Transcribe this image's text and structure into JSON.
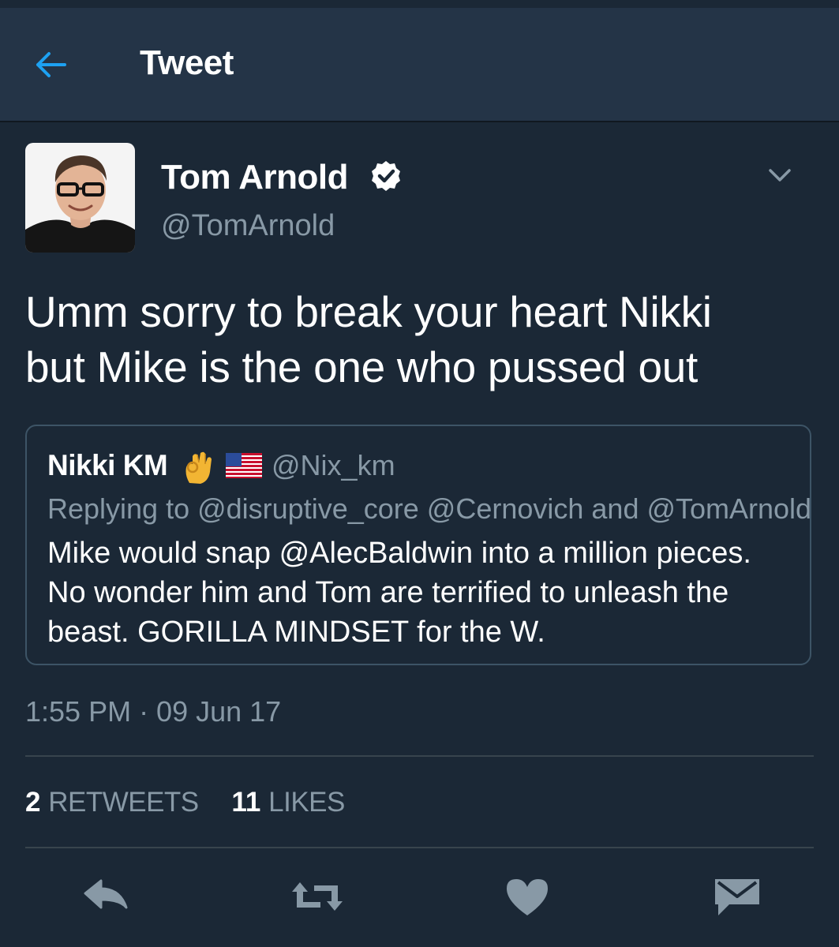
{
  "header": {
    "title": "Tweet",
    "back_icon": "back-arrow-icon",
    "accent_color": "#1da1f2"
  },
  "tweet": {
    "author_name": "Tom Arnold",
    "author_handle": "@TomArnold",
    "verified": true,
    "text": "Umm sorry to break your heart Nikki\nbut Mike is the one who pussed out",
    "timestamp": "1:55 PM · 09 Jun 17",
    "retweets_count": "2",
    "retweets_label": "RETWEETS",
    "likes_count": "11",
    "likes_label": "LIKES"
  },
  "quoted_tweet": {
    "author_name": "Nikki KM",
    "emojis": [
      "ok-hand",
      "us-flag"
    ],
    "author_handle": "@Nix_km",
    "replying_to": "Replying to @disruptive_core @Cernovich and @TomArnold",
    "text": "Mike would snap @AlecBaldwin into a million pieces.\nNo wonder him and Tom are terrified to unleash the\nbeast. GORILLA MINDSET for the W."
  },
  "actions": [
    {
      "name": "reply",
      "icon": "reply-icon"
    },
    {
      "name": "retweet",
      "icon": "retweet-icon"
    },
    {
      "name": "like",
      "icon": "heart-icon"
    },
    {
      "name": "direct-message",
      "icon": "envelope-icon"
    }
  ],
  "colors": {
    "background": "#1b2836",
    "header_background": "#243447",
    "secondary_text": "#8899a6",
    "border": "#3d5466",
    "icon_gray": "#8899a6"
  }
}
